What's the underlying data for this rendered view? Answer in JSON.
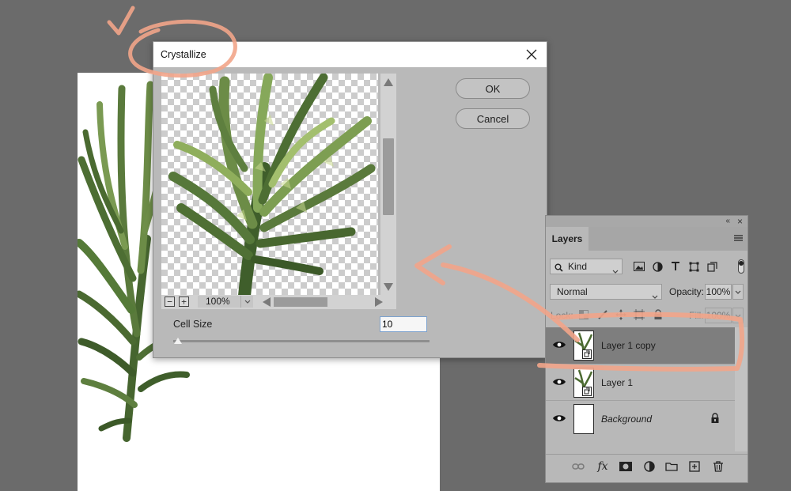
{
  "dialog": {
    "title": "Crystallize",
    "ok_label": "OK",
    "cancel_label": "Cancel",
    "zoom_level": "100%",
    "cell_size_label": "Cell Size",
    "cell_size_value": "10"
  },
  "layers_panel": {
    "tab_label": "Layers",
    "filter_kind": "Kind",
    "blend_mode": "Normal",
    "opacity_label": "Opacity:",
    "opacity_value": "100%",
    "lock_label": "Lock:",
    "fill_label": "Fill:",
    "fill_value": "100%",
    "layers": [
      {
        "name": "Layer 1 copy",
        "selected": true
      },
      {
        "name": "Layer 1",
        "selected": false
      },
      {
        "name": "Background",
        "selected": false
      }
    ]
  },
  "colors": {
    "annotation": "#f2a58a",
    "workspace": "#6b6b6b",
    "dialog_bg": "#b9b9b9",
    "selected_layer": "#7e7e7e",
    "foliage_dark": "#3f5e2b",
    "foliage_light": "#8fae5c"
  },
  "icons": {
    "dialog_close": "close-icon",
    "zoom_out": "minus-box-icon",
    "zoom_in": "plus-box-icon",
    "visibility": "eye-icon",
    "background_lock": "padlock-icon",
    "panel_menu": "hamburger-menu-icon"
  }
}
